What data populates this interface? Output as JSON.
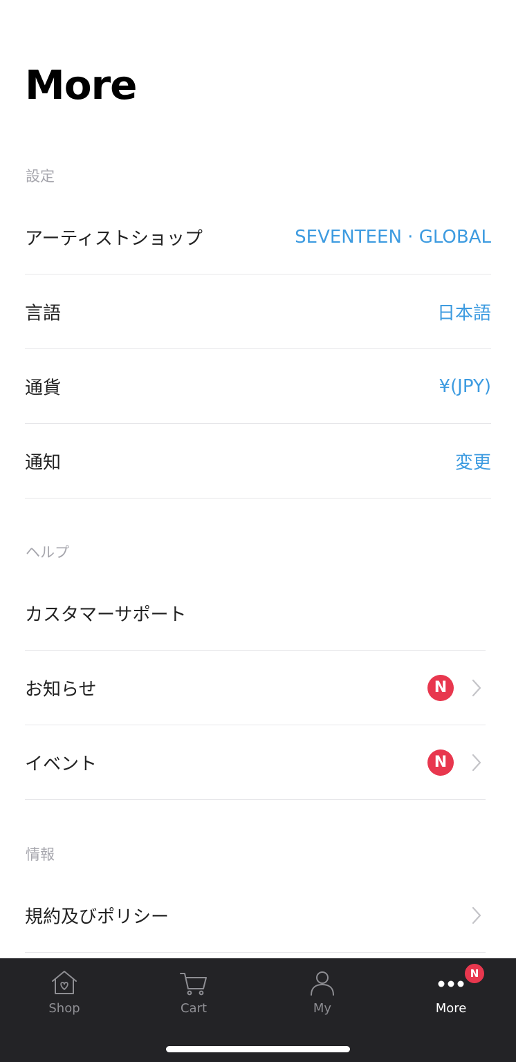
{
  "page": {
    "title": "More"
  },
  "settings": {
    "section_label": "設定",
    "artist_shop": {
      "label": "アーティストショップ",
      "value": "SEVENTEEN · GLOBAL"
    },
    "language": {
      "label": "言語",
      "value": "日本語"
    },
    "currency": {
      "label": "通貨",
      "value": "¥(JPY)"
    },
    "notification": {
      "label": "通知",
      "value": "変更"
    }
  },
  "help": {
    "section_label": "ヘルプ",
    "customer_support": {
      "label": "カスタマーサポート"
    },
    "notices": {
      "label": "お知らせ",
      "badge": "N"
    },
    "events": {
      "label": "イベント",
      "badge": "N"
    }
  },
  "info": {
    "section_label": "情報",
    "terms": {
      "label": "規約及びポリシー"
    }
  },
  "tabbar": {
    "tabs": [
      {
        "label": "Shop",
        "icon": "home-icon"
      },
      {
        "label": "Cart",
        "icon": "cart-icon"
      },
      {
        "label": "My",
        "icon": "person-icon"
      },
      {
        "label": "More",
        "icon": "more-dots-icon",
        "badge": "N",
        "active": true
      }
    ]
  },
  "colors": {
    "accent": "#3d9be0",
    "badge": "#e8374e",
    "tabbar_bg": "#232326",
    "section_label": "#a6a6ad"
  }
}
